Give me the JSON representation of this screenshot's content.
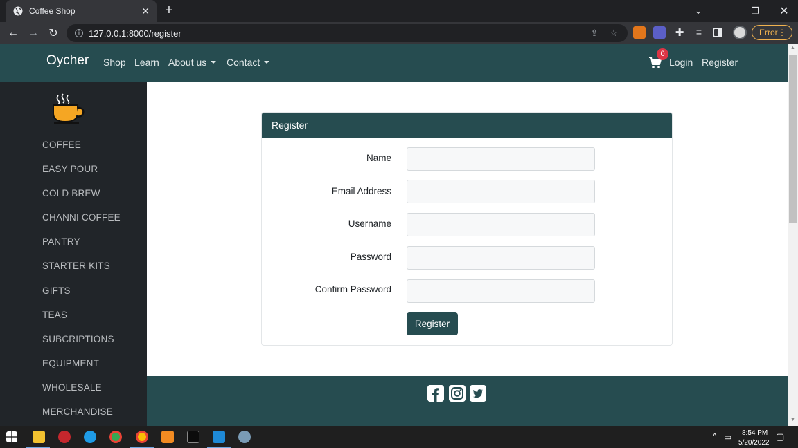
{
  "browser": {
    "tab_title": "Coffee Shop",
    "url": "127.0.0.1:8000/register",
    "error_label": "Error"
  },
  "navbar": {
    "brand": "Oycher",
    "links": [
      "Shop",
      "Learn",
      "About us",
      "Contact"
    ],
    "cart_count": "0",
    "login": "Login",
    "register": "Register"
  },
  "sidebar": {
    "items": [
      "COFFEE",
      "EASY POUR",
      "COLD BREW",
      "CHANNI COFFEE",
      "PANTRY",
      "STARTER KITS",
      "GIFTS",
      "TEAS",
      "SUBCRIPTIONS",
      "EQUIPMENT",
      "WHOLESALE",
      "MERCHANDISE"
    ]
  },
  "form": {
    "header": "Register",
    "labels": [
      "Name",
      "Email Address",
      "Username",
      "Password",
      "Confirm Password"
    ],
    "values": [
      "",
      "",
      "",
      "",
      ""
    ],
    "submit": "Register"
  },
  "footer": {
    "icons": [
      "facebook-icon",
      "instagram-icon",
      "twitter-icon"
    ]
  },
  "taskbar": {
    "time": "8:54 PM",
    "date": "5/20/2022"
  },
  "colors": {
    "brand_teal": "#264c50",
    "sidebar_dark": "#212529",
    "badge_red": "#dc3545"
  }
}
